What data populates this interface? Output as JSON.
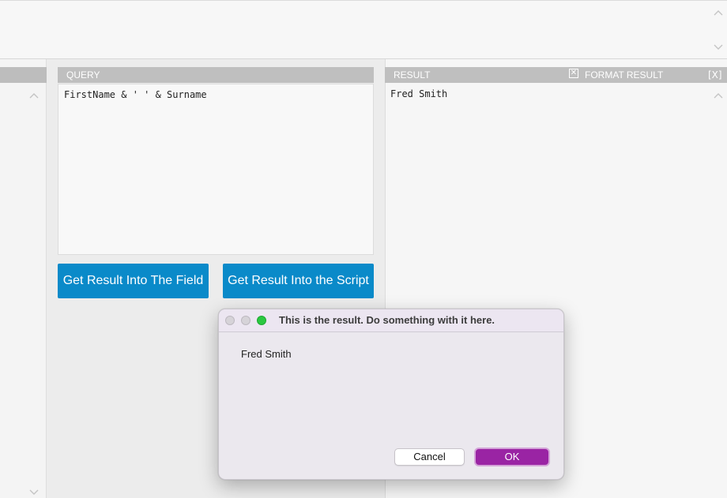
{
  "query_panel": {
    "header": "QUERY",
    "expression": "FirstName & ' ' & Surname",
    "button_field": "Get Result Into The Field",
    "button_script": "Get Result Into the Script"
  },
  "result_panel": {
    "header": "RESULT",
    "format_label": "FORMAT RESULT",
    "format_checked_glyph": "✕",
    "close_label": "[X]",
    "value": "Fred Smith"
  },
  "dialog": {
    "title": "This is the result. Do something with it here.",
    "message": "Fred Smith",
    "cancel_label": "Cancel",
    "ok_label": "OK"
  },
  "colors": {
    "action_button": "#0a8ac9",
    "ok_button": "#9a24a4",
    "panel_header": "#bfbfbf",
    "traffic_green": "#2ac840"
  },
  "icons": {
    "scroll_up": "chevron-up-icon",
    "scroll_down": "chevron-down-icon",
    "checkbox": "checkbox-checked-icon"
  }
}
